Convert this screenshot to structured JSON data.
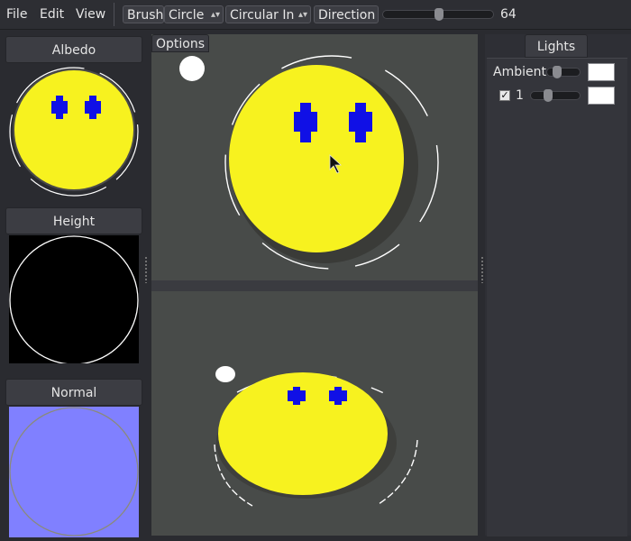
{
  "menu": {
    "items": [
      "File",
      "Edit",
      "View"
    ]
  },
  "toolbar": {
    "brush_label": "Brush",
    "shape_value": "Circle",
    "falloff_value": "Circular In",
    "direction_label": "Direction",
    "size_value": "64",
    "size_level": 0.5
  },
  "left_panel": {
    "albedo_label": "Albedo",
    "height_label": "Height",
    "normal_label": "Normal"
  },
  "viewport": {
    "options_label": "Options"
  },
  "lights": {
    "tab_label": "Lights",
    "ambient_label": "Ambient",
    "ambient_level": 0.2,
    "light1_label": "1",
    "light1_enabled": true,
    "light1_level": 0.3,
    "ambient_color": "#ffffff",
    "light1_color": "#ffffff"
  },
  "colors": {
    "background": "#2a2b30",
    "viewport": "#484b49",
    "face_fill": "#f7f21f",
    "eye_fill": "#1010e6",
    "normal_map": "#8080ff"
  }
}
